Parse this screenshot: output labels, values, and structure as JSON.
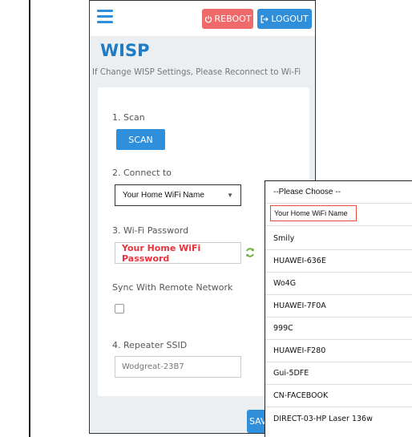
{
  "header": {
    "reboot_label": "REBOOT",
    "logout_label": "LOGOUT"
  },
  "page": {
    "title": "WISP",
    "subtitle": "If Change WISP Settings, Please Reconnect to Wi-Fi"
  },
  "form": {
    "scan_label": "1. Scan",
    "scan_button": "SCAN",
    "connect_label": "2. Connect to",
    "connect_selected": "Your Home WiFi Name",
    "password_label": "3. Wi-Fi Password",
    "password_value": "Your Home WiFi Password",
    "sync_label": "Sync With Remote Network",
    "ssid_label": "4. Repeater SSID",
    "ssid_value": "Wodgreat-23B7",
    "save_button": "SAV"
  },
  "dropdown": {
    "placeholder": "--Please Choose --",
    "selected": "Your Home WiFi Name",
    "options": [
      "Smily",
      "HUAWEI-636E",
      "Wo4G",
      "HUAWEI-7F0A",
      "999C",
      "HUAWEI-F280",
      "Gui-5DFE",
      "CN-FACEBOOK",
      "DIRECT-03-HP Laser 136w"
    ]
  },
  "colors": {
    "accent": "#2f8fdb",
    "danger": "#ef6a6a",
    "title": "#1f7cc4",
    "password_text": "#e8323c"
  },
  "icons": {
    "menu": "hamburger-icon",
    "reboot": "power-icon",
    "logout": "logout-icon",
    "refresh": "refresh-icon",
    "select": "chevron-down-icon"
  }
}
